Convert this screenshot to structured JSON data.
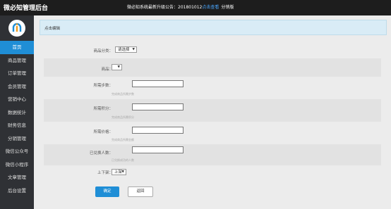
{
  "header": {
    "brand": "微必知管理后台",
    "notice_prefix": "微必知系统最新升级公告：201801012",
    "notice_link": "点击查看",
    "notice_suffix": "分销版"
  },
  "sidebar": {
    "items": [
      {
        "label": "首页",
        "active": true
      },
      {
        "label": "商品管理"
      },
      {
        "label": "订单管理"
      },
      {
        "label": "会员管理"
      },
      {
        "label": "营销中心"
      },
      {
        "label": "数据统计"
      },
      {
        "label": "财务信息"
      },
      {
        "label": "分销管理"
      },
      {
        "label": "微信公众号"
      },
      {
        "label": "微信小程序"
      },
      {
        "label": "文章管理"
      },
      {
        "label": "后台设置"
      }
    ]
  },
  "breadcrumb": "点击编辑",
  "form": {
    "category_label": "商品分类：",
    "category_value": "请选择",
    "product_label": "商品：",
    "product_value": "",
    "steps_label": "所需步数：",
    "steps_hint": "完成商品所需步数",
    "points_label": "所需积分：",
    "points_hint": "完成商品所需积分",
    "price_label": "所需价格：",
    "price_hint": "完成商品所需金额",
    "participants_label": "已兑换人数：",
    "participants_hint": "已兑换成功的人数",
    "shelf_label": "上下架：",
    "shelf_value": "上架"
  },
  "buttons": {
    "confirm": "确定",
    "back": "返回"
  }
}
